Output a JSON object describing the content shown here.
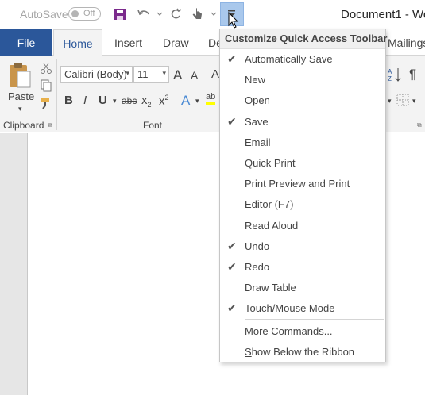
{
  "titlebar": {
    "autosave_label": "AutoSave",
    "autosave_state": "Off",
    "doc_title": "Document1  -  Wo"
  },
  "tabs": {
    "file": "File",
    "home": "Home",
    "insert": "Insert",
    "draw": "Draw",
    "design_partial": "De",
    "mailings": "Mailings"
  },
  "ribbon": {
    "paste_label": "Paste",
    "font_name": "Calibri (Body)",
    "font_size": "11",
    "clipboard_group": "Clipboard",
    "font_group": "Font",
    "bold": "B",
    "italic": "I",
    "underline": "U",
    "strike": "abc",
    "subscript": "x",
    "superscript": "x",
    "grow_font": "A",
    "shrink_font": "A",
    "text_effects": "A",
    "highlight": "ab",
    "pilcrow": "¶"
  },
  "menu": {
    "header": "Customize Quick Access Toolbar",
    "items": [
      {
        "label": "Automatically Save",
        "checked": true
      },
      {
        "label": "New",
        "checked": false
      },
      {
        "label": "Open",
        "checked": false
      },
      {
        "label": "Save",
        "checked": true
      },
      {
        "label": "Email",
        "checked": false
      },
      {
        "label": "Quick Print",
        "checked": false
      },
      {
        "label": "Print Preview and Print",
        "checked": false
      },
      {
        "label": "Editor (F7)",
        "checked": false
      },
      {
        "label": "Read Aloud",
        "checked": false
      },
      {
        "label": "Undo",
        "checked": true
      },
      {
        "label": "Redo",
        "checked": true
      },
      {
        "label": "Draw Table",
        "checked": false
      },
      {
        "label": "Touch/Mouse Mode",
        "checked": true
      }
    ],
    "more_commands": "More Commands...",
    "show_below": "Show Below the Ribbon",
    "check_glyph": "✔"
  },
  "colors": {
    "accent": "#2b579a",
    "qat_highlight": "#a9c8ec",
    "save_icon": "#6a1b9a"
  }
}
